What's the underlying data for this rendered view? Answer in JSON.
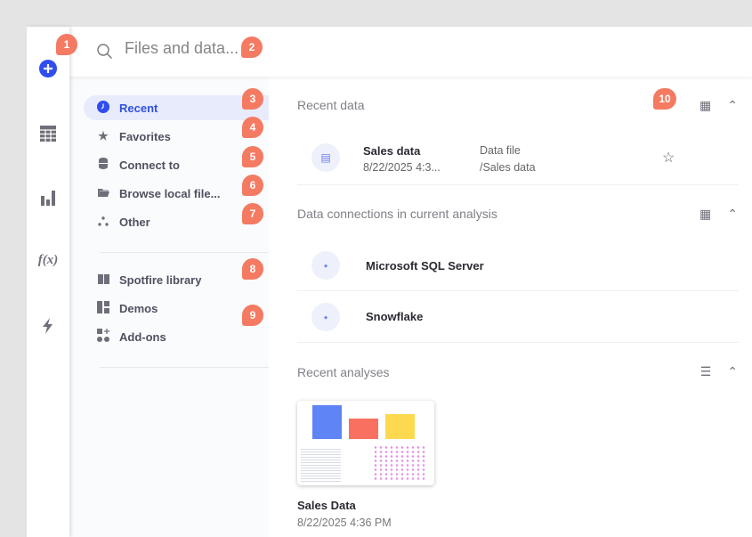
{
  "search": {
    "placeholder": "Files and data..."
  },
  "nav": {
    "items": [
      {
        "label": "Recent",
        "icon": "clock-icon"
      },
      {
        "label": "Favorites",
        "icon": "star-icon"
      },
      {
        "label": "Connect to",
        "icon": "database-icon"
      },
      {
        "label": "Browse local file...",
        "icon": "folder-icon"
      },
      {
        "label": "Other",
        "icon": "dots-icon"
      }
    ],
    "library": [
      {
        "label": "Spotfire library",
        "icon": "book-icon"
      },
      {
        "label": "Demos",
        "icon": "demos-icon"
      },
      {
        "label": "Add-ons",
        "icon": "addons-icon"
      }
    ]
  },
  "recent_data": {
    "title": "Recent data",
    "items": [
      {
        "name": "Sales data",
        "date": "8/22/2025 4:3...",
        "type": "Data file",
        "path": "/Sales data"
      }
    ]
  },
  "connections": {
    "title": "Data connections in current analysis",
    "items": [
      {
        "name": "Microsoft SQL Server"
      },
      {
        "name": "Snowflake"
      }
    ]
  },
  "recent_analyses": {
    "title": "Recent analyses",
    "items": [
      {
        "name": "Sales Data",
        "date": "8/22/2025 4:36 PM"
      }
    ]
  },
  "badges": [
    "1",
    "2",
    "3",
    "4",
    "5",
    "6",
    "7",
    "8",
    "9",
    "10"
  ],
  "colors": {
    "accent": "#3050e0",
    "badge": "#f47a62"
  }
}
